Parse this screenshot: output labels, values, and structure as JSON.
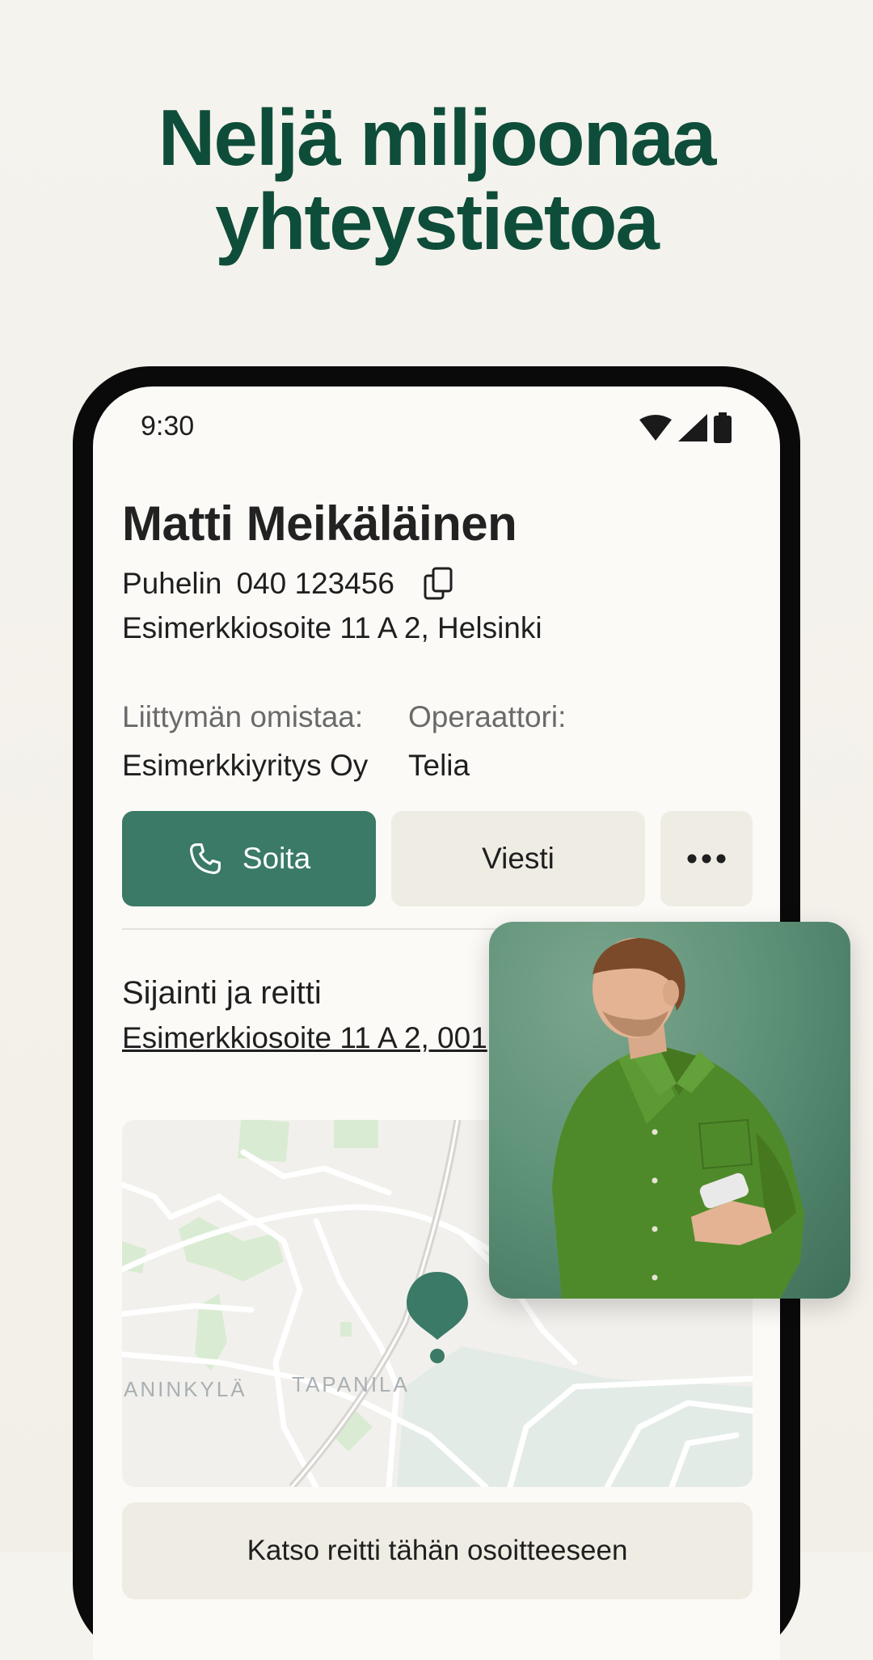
{
  "headline": {
    "line1": "Neljä miljoonaa",
    "line2": "yhteystietoa"
  },
  "status_bar": {
    "time": "9:30"
  },
  "contact": {
    "name": "Matti Meikäläinen",
    "phone_label": "Puhelin",
    "phone_number": "040 123456",
    "address": "Esimerkkiosoite 11 A 2, Helsinki",
    "owner_label": "Liittymän omistaa:",
    "owner_value": "Esimerkkiyritys Oy",
    "operator_label": "Operaattori:",
    "operator_value": "Telia"
  },
  "actions": {
    "call_label": "Soita",
    "message_label": "Viesti"
  },
  "location": {
    "title": "Sijainti ja reitti",
    "address": "Esimerkkiosoite 11 A 2, 001",
    "map_labels": [
      "ANINKYLÄ",
      "TAPANILA"
    ],
    "route_button": "Katso reitti tähän osoitteeseen"
  },
  "colors": {
    "headline": "#0e4d39",
    "primary_button": "#3a7a67",
    "secondary_button": "#efece3"
  }
}
